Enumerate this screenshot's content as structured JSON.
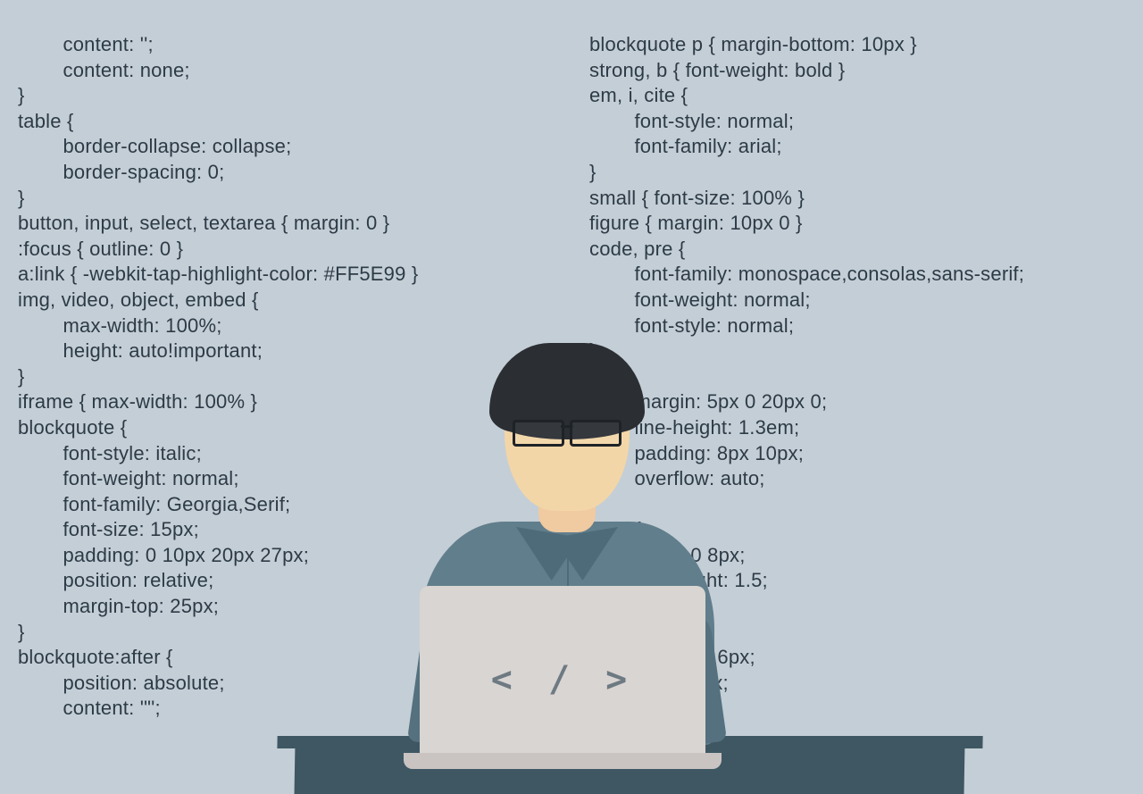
{
  "laptop_glyph": "< / >",
  "left_code": "        content: '';\n        content: none;\n}\ntable {\n        border-collapse: collapse;\n        border-spacing: 0;\n}\nbutton, input, select, textarea { margin: 0 }\n:focus { outline: 0 }\na:link { -webkit-tap-highlight-color: #FF5E99 }\nimg, video, object, embed {\n        max-width: 100%;\n        height: auto!important;\n}\niframe { max-width: 100% }\nblockquote {\n        font-style: italic;\n        font-weight: normal;\n        font-family: Georgia,Serif;\n        font-size: 15px;\n        padding: 0 10px 20px 27px;\n        position: relative;\n        margin-top: 25px;\n}\nblockquote:after {\n        position: absolute;\n        content: '\"';",
  "right_code": "blockquote p { margin-bottom: 10px }\nstrong, b { font-weight: bold }\nem, i, cite {\n        font-style: normal;\n        font-family: arial;\n}\nsmall { font-size: 100% }\nfigure { margin: 10px 0 }\ncode, pre {\n        font-family: monospace,consolas,sans-serif;\n        font-weight: normal;\n        font-style: normal;\n}\npre {\n        margin: 5px 0 20px 0;\n        line-height: 1.3em;\n        padding: 8px 10px;\n        overflow: auto;\n}\n        {\n              g: 0 8px;\n                eight: 1.5;\n}\n           5px;\n              : 1px 6px;\n               0 2px;\n                ack;"
}
